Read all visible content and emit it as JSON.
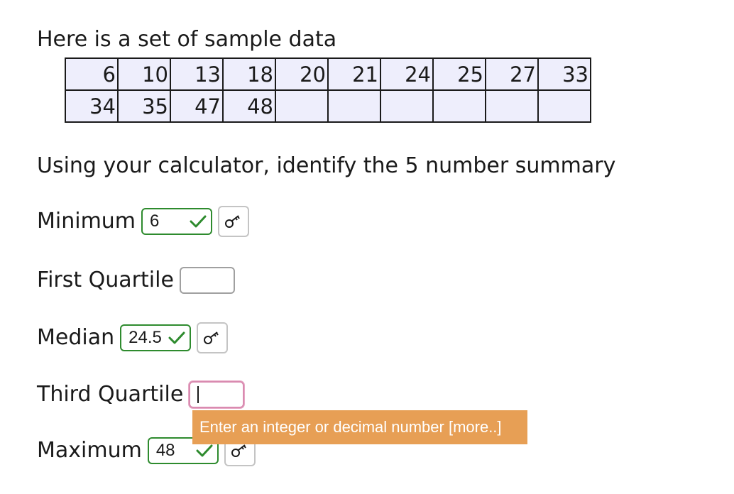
{
  "intro_text": "Here is a set of sample data",
  "data_table": {
    "rows": [
      [
        "6",
        "10",
        "13",
        "18",
        "20",
        "21",
        "24",
        "25",
        "27",
        "33"
      ],
      [
        "34",
        "35",
        "47",
        "48",
        "",
        "",
        "",
        "",
        "",
        ""
      ]
    ]
  },
  "question_text": "Using your calculator, identify the 5 number summary",
  "fields": {
    "minimum": {
      "label": "Minimum",
      "value": "6",
      "status": "correct"
    },
    "first_quartile": {
      "label": "First Quartile",
      "value": "",
      "status": "empty"
    },
    "median": {
      "label": "Median",
      "value": "24.5",
      "status": "correct"
    },
    "third_quartile": {
      "label": "Third Quartile",
      "value": "",
      "status": "active"
    },
    "maximum": {
      "label": "Maximum",
      "value": "48",
      "status": "correct"
    }
  },
  "tooltip_text": "Enter an integer or decimal number [more..]",
  "icons": {
    "check": "check-icon",
    "key": "key-icon"
  },
  "colors": {
    "correct_border": "#2e8b2e",
    "active_border": "#d98bb0",
    "tooltip_bg": "#e79f55",
    "table_bg": "#eeeefc"
  }
}
